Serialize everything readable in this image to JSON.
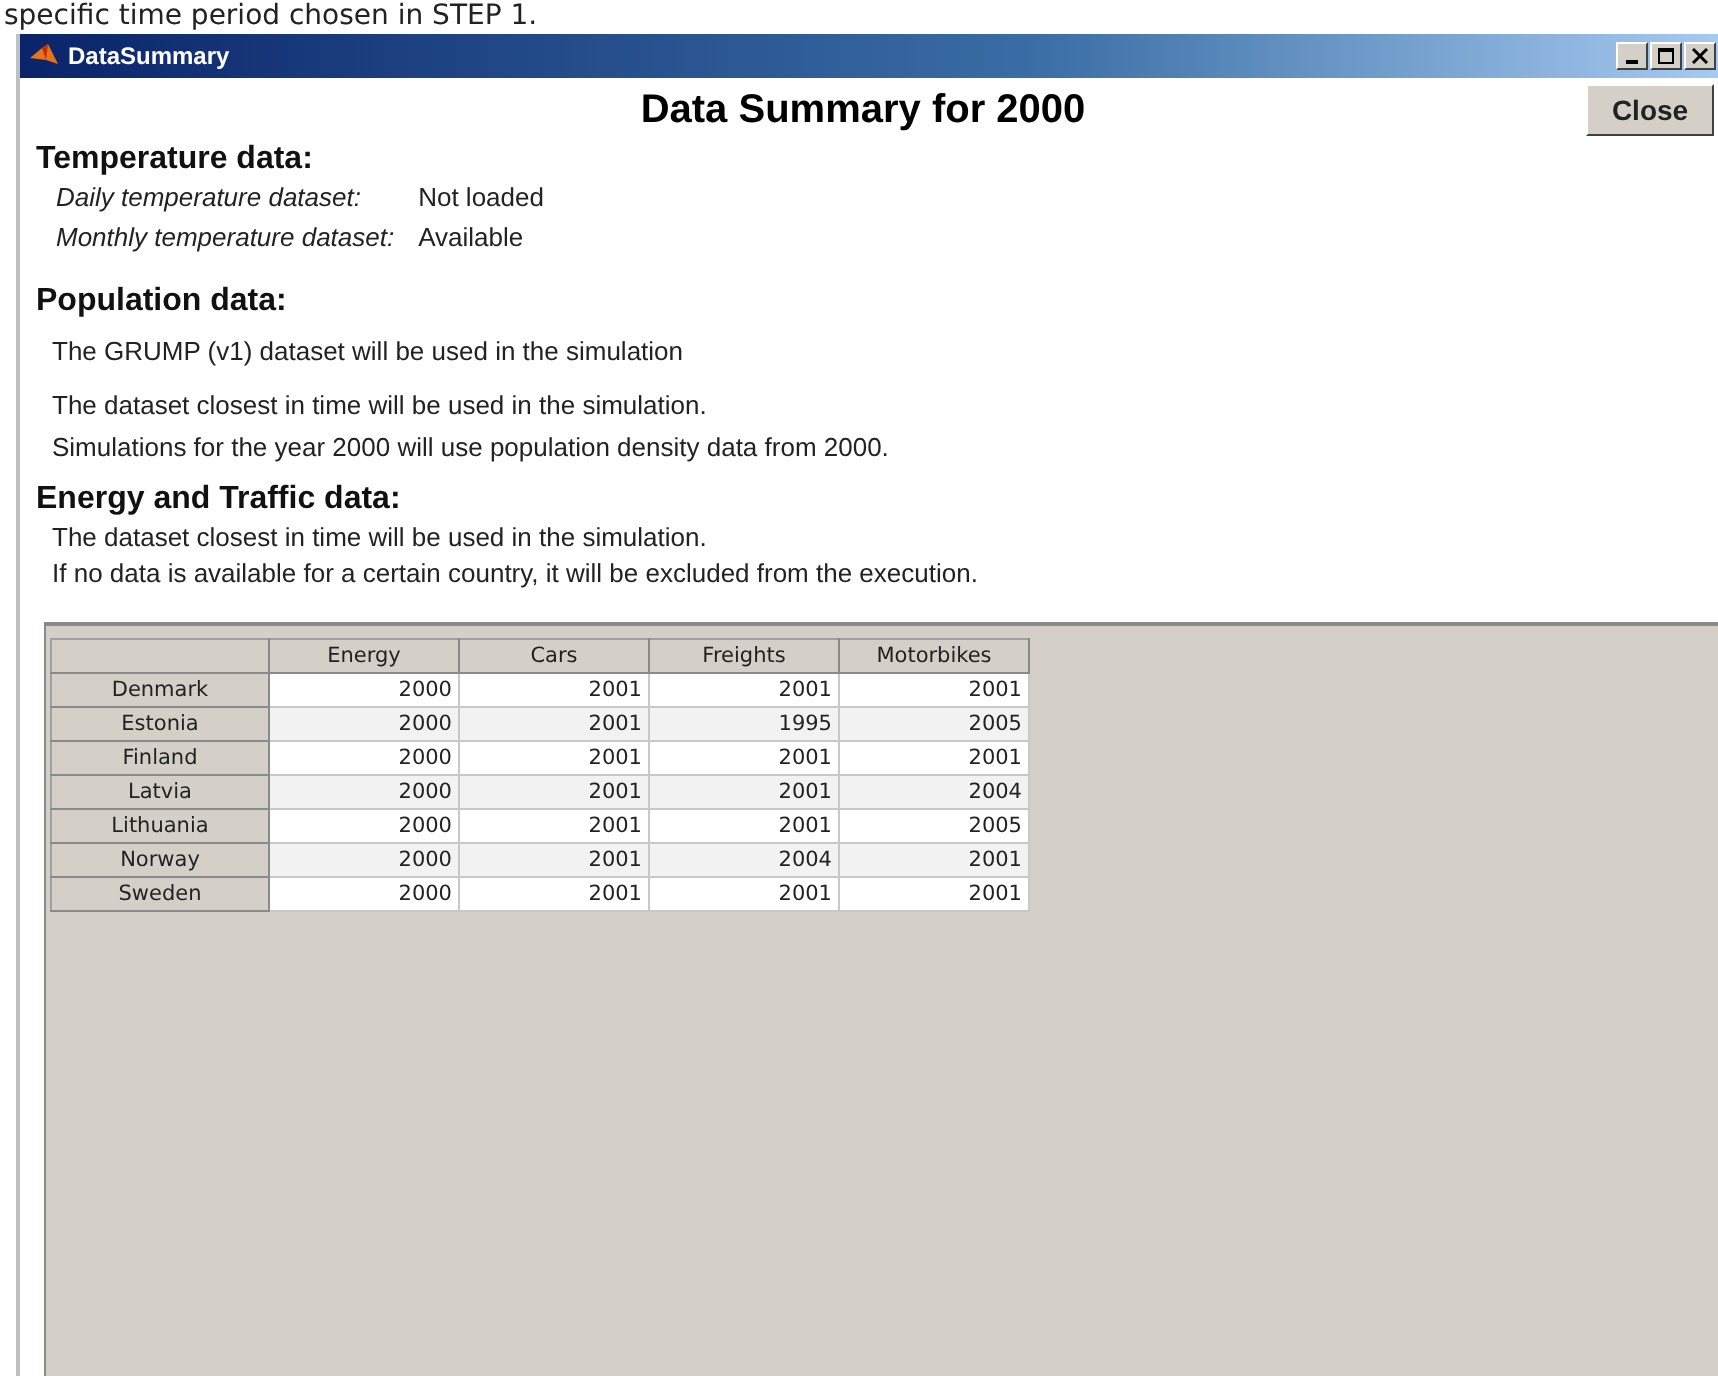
{
  "caption": "specific time period chosen in STEP 1.",
  "window": {
    "title": "DataSummary"
  },
  "heading": "Data Summary for 2000",
  "close_button": "Close",
  "temperature": {
    "title": "Temperature data:",
    "rows": [
      {
        "label": "Daily temperature dataset:",
        "value": "Not loaded"
      },
      {
        "label": "Monthly temperature dataset:",
        "value": "Available"
      }
    ]
  },
  "population": {
    "title": "Population data:",
    "lines": [
      "The GRUMP (v1) dataset will be used in the simulation",
      "The dataset closest in time will be used in the simulation.",
      "Simulations for the year 2000 will use population density data from 2000."
    ]
  },
  "energy": {
    "title": "Energy and Traffic data:",
    "lines": [
      "The dataset closest in time will be used in the simulation.",
      "If no data is available for a certain country, it will be excluded from the execution."
    ]
  },
  "table": {
    "columns": [
      "Energy",
      "Cars",
      "Freights",
      "Motorbikes"
    ],
    "rows": [
      {
        "name": "Denmark",
        "cells": [
          "2000",
          "2001",
          "2001",
          "2001"
        ]
      },
      {
        "name": "Estonia",
        "cells": [
          "2000",
          "2001",
          "1995",
          "2005"
        ]
      },
      {
        "name": "Finland",
        "cells": [
          "2000",
          "2001",
          "2001",
          "2001"
        ]
      },
      {
        "name": "Latvia",
        "cells": [
          "2000",
          "2001",
          "2001",
          "2004"
        ]
      },
      {
        "name": "Lithuania",
        "cells": [
          "2000",
          "2001",
          "2001",
          "2005"
        ]
      },
      {
        "name": "Norway",
        "cells": [
          "2000",
          "2001",
          "2004",
          "2001"
        ]
      },
      {
        "name": "Sweden",
        "cells": [
          "2000",
          "2001",
          "2001",
          "2001"
        ]
      }
    ]
  }
}
